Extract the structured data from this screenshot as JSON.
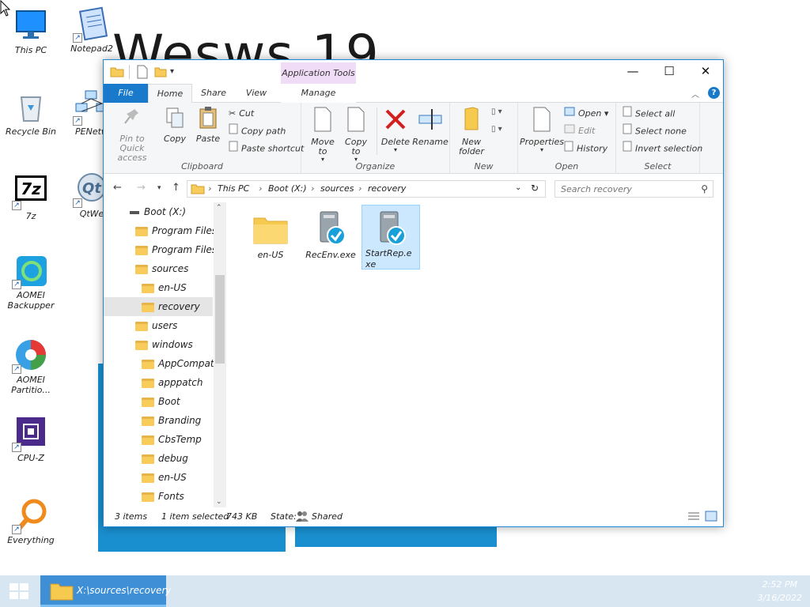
{
  "wallpaper": {
    "title": "Wesws 19"
  },
  "desktop": {
    "icons": [
      {
        "label": "This PC",
        "icon": "monitor-icon"
      },
      {
        "label": "Notepad2",
        "icon": "notepad-icon"
      },
      {
        "label": "Recycle Bin",
        "icon": "recycle-bin-icon"
      },
      {
        "label": "PENetw",
        "icon": "network-icon"
      },
      {
        "label": "7z",
        "icon": "7zip-icon"
      },
      {
        "label": "QtWe",
        "icon": "qt-icon"
      },
      {
        "label": "AOMEI Backupper",
        "icon": "aomei-backupper-icon"
      },
      {
        "label": "AOMEI Partitio...",
        "icon": "aomei-partition-icon"
      },
      {
        "label": "CPU-Z",
        "icon": "cpu-z-icon"
      },
      {
        "label": "Everything",
        "icon": "everything-icon"
      }
    ]
  },
  "explorer": {
    "context_tab": "Application Tools",
    "window_controls": {
      "minimize": "—",
      "maximize": "☐",
      "close": "✕"
    },
    "tabs": [
      "File",
      "Home",
      "Share",
      "View",
      "Manage"
    ],
    "ribbon": {
      "clipboard": {
        "title": "Clipboard",
        "pin": "Pin to Quick access",
        "copy": "Copy",
        "paste": "Paste",
        "cut": "Cut",
        "copy_path": "Copy path",
        "paste_shortcut": "Paste shortcut"
      },
      "organize": {
        "title": "Organize",
        "move_to": "Move to",
        "copy_to": "Copy to",
        "delete": "Delete",
        "rename": "Rename"
      },
      "new": {
        "title": "New",
        "new_folder": "New folder"
      },
      "open": {
        "title": "Open",
        "properties": "Properties",
        "open": "Open",
        "edit": "Edit",
        "history": "History"
      },
      "select": {
        "title": "Select",
        "select_all": "Select all",
        "select_none": "Select none",
        "invert": "Invert selection"
      }
    },
    "breadcrumb": [
      "This PC",
      "Boot (X:)",
      "sources",
      "recovery"
    ],
    "search_placeholder": "Search recovery",
    "tree": [
      {
        "label": "Boot (X:)",
        "level": 0,
        "type": "drive"
      },
      {
        "label": "Program Files",
        "level": 1
      },
      {
        "label": "Program Files (",
        "level": 1
      },
      {
        "label": "sources",
        "level": 1
      },
      {
        "label": "en-US",
        "level": 2
      },
      {
        "label": "recovery",
        "level": 2,
        "selected": true
      },
      {
        "label": "users",
        "level": 1
      },
      {
        "label": "windows",
        "level": 1
      },
      {
        "label": "AppCompat",
        "level": 2
      },
      {
        "label": "apppatch",
        "level": 2
      },
      {
        "label": "Boot",
        "level": 2
      },
      {
        "label": "Branding",
        "level": 2
      },
      {
        "label": "CbsTemp",
        "level": 2
      },
      {
        "label": "debug",
        "level": 2
      },
      {
        "label": "en-US",
        "level": 2
      },
      {
        "label": "Fonts",
        "level": 2
      }
    ],
    "files": [
      {
        "name": "en-US",
        "type": "folder",
        "selected": false
      },
      {
        "name": "RecEnv.exe",
        "type": "exe",
        "selected": false
      },
      {
        "name": "StartRep.exe",
        "type": "exe",
        "selected": true
      }
    ],
    "status": {
      "count": "3 items",
      "selection": "1 item selected",
      "size": "743 KB",
      "state_label": "State:",
      "state_value": "Shared"
    }
  },
  "taskbar": {
    "active_window": "X:\\sources\\recovery",
    "time": "2:52 PM",
    "date": "3/16/2022"
  },
  "colors": {
    "accent": "#1979ca",
    "wallpaper_tile": "#1a8fcf",
    "selection": "#cce8ff",
    "context_tab": "#f1dcf7"
  }
}
